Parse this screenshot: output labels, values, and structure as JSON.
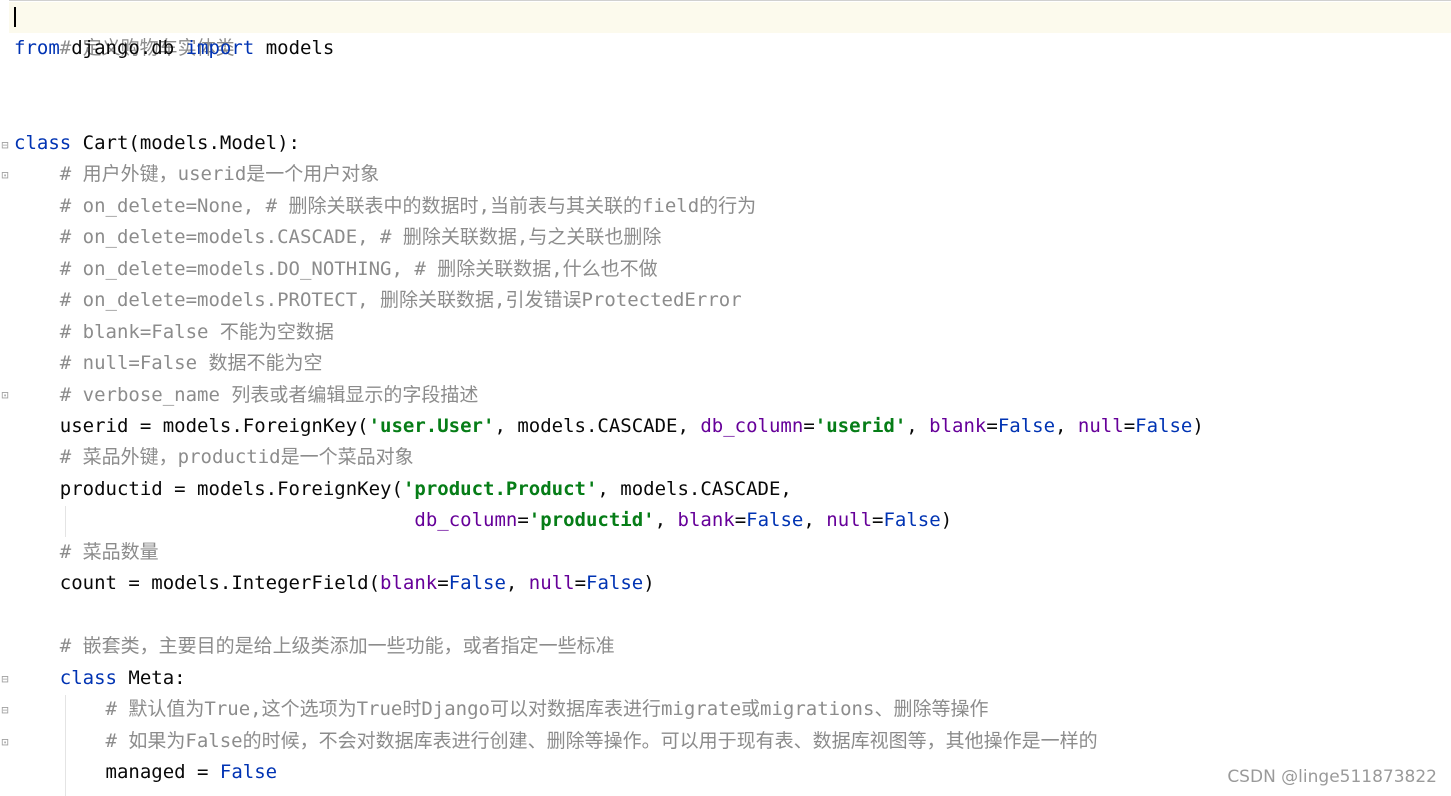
{
  "editor": {
    "lines": {
      "l1": {
        "c": "# 定义购物车实体类"
      },
      "l2": {
        "k1": "from",
        "t1": " django.db ",
        "k2": "import",
        "t2": " models"
      },
      "l5": {
        "k1": "class",
        "t1": " Cart(models.Model):"
      },
      "l6": {
        "c": "    # 用户外键，userid是一个用户对象"
      },
      "l7": {
        "c": "    # on_delete=None, # 删除关联表中的数据时,当前表与其关联的field的行为"
      },
      "l8": {
        "c": "    # on_delete=models.CASCADE, # 删除关联数据,与之关联也删除"
      },
      "l9": {
        "c": "    # on_delete=models.DO_NOTHING, # 删除关联数据,什么也不做"
      },
      "l10": {
        "c": "    # on_delete=models.PROTECT, 删除关联数据,引发错误ProtectedError"
      },
      "l11": {
        "c": "    # blank=False 不能为空数据"
      },
      "l12": {
        "c": "    # null=False 数据不能为空"
      },
      "l13": {
        "c": "    # verbose_name 列表或者编辑显示的字段描述"
      },
      "l14": {
        "t1": "    userid = models.ForeignKey(",
        "s1": "'user.User'",
        "t2": ", models.CASCADE, ",
        "p1": "db_column",
        "t3": "=",
        "s2": "'userid'",
        "t4": ", ",
        "p2": "blank",
        "t5": "=",
        "k1": "False",
        "t6": ", ",
        "p3": "null",
        "t7": "=",
        "k2": "False",
        "t8": ")"
      },
      "l15": {
        "c": "    # 菜品外键，productid是一个菜品对象"
      },
      "l16": {
        "t1": "    productid = models.ForeignKey(",
        "s1": "'product.Product'",
        "t2": ", models.CASCADE,"
      },
      "l17": {
        "t1": "                                   ",
        "p1": "db_column",
        "t2": "=",
        "s1": "'productid'",
        "t3": ", ",
        "p2": "blank",
        "t4": "=",
        "k1": "False",
        "t5": ", ",
        "p3": "null",
        "t6": "=",
        "k2": "False",
        "t7": ")"
      },
      "l18": {
        "c": "    # 菜品数量"
      },
      "l19": {
        "t1": "    count = models.IntegerField(",
        "p1": "blank",
        "t2": "=",
        "k1": "False",
        "t3": ", ",
        "p2": "null",
        "t4": "=",
        "k2": "False",
        "t5": ")"
      },
      "l21": {
        "c": "    # 嵌套类，主要目的是给上级类添加一些功能，或者指定一些标准"
      },
      "l22": {
        "t0": "    ",
        "k1": "class",
        "t1": " Meta:"
      },
      "l23": {
        "c": "        # 默认值为True,这个选项为True时Django可以对数据库表进行migrate或migrations、删除等操作"
      },
      "l24": {
        "c": "        # 如果为False的时候，不会对数据库表进行创建、删除等操作。可以用于现有表、数据库视图等，其他操作是一样的"
      },
      "l25": {
        "t1": "        managed = ",
        "k1": "False"
      }
    }
  },
  "watermark": "CSDN @linge511873822"
}
